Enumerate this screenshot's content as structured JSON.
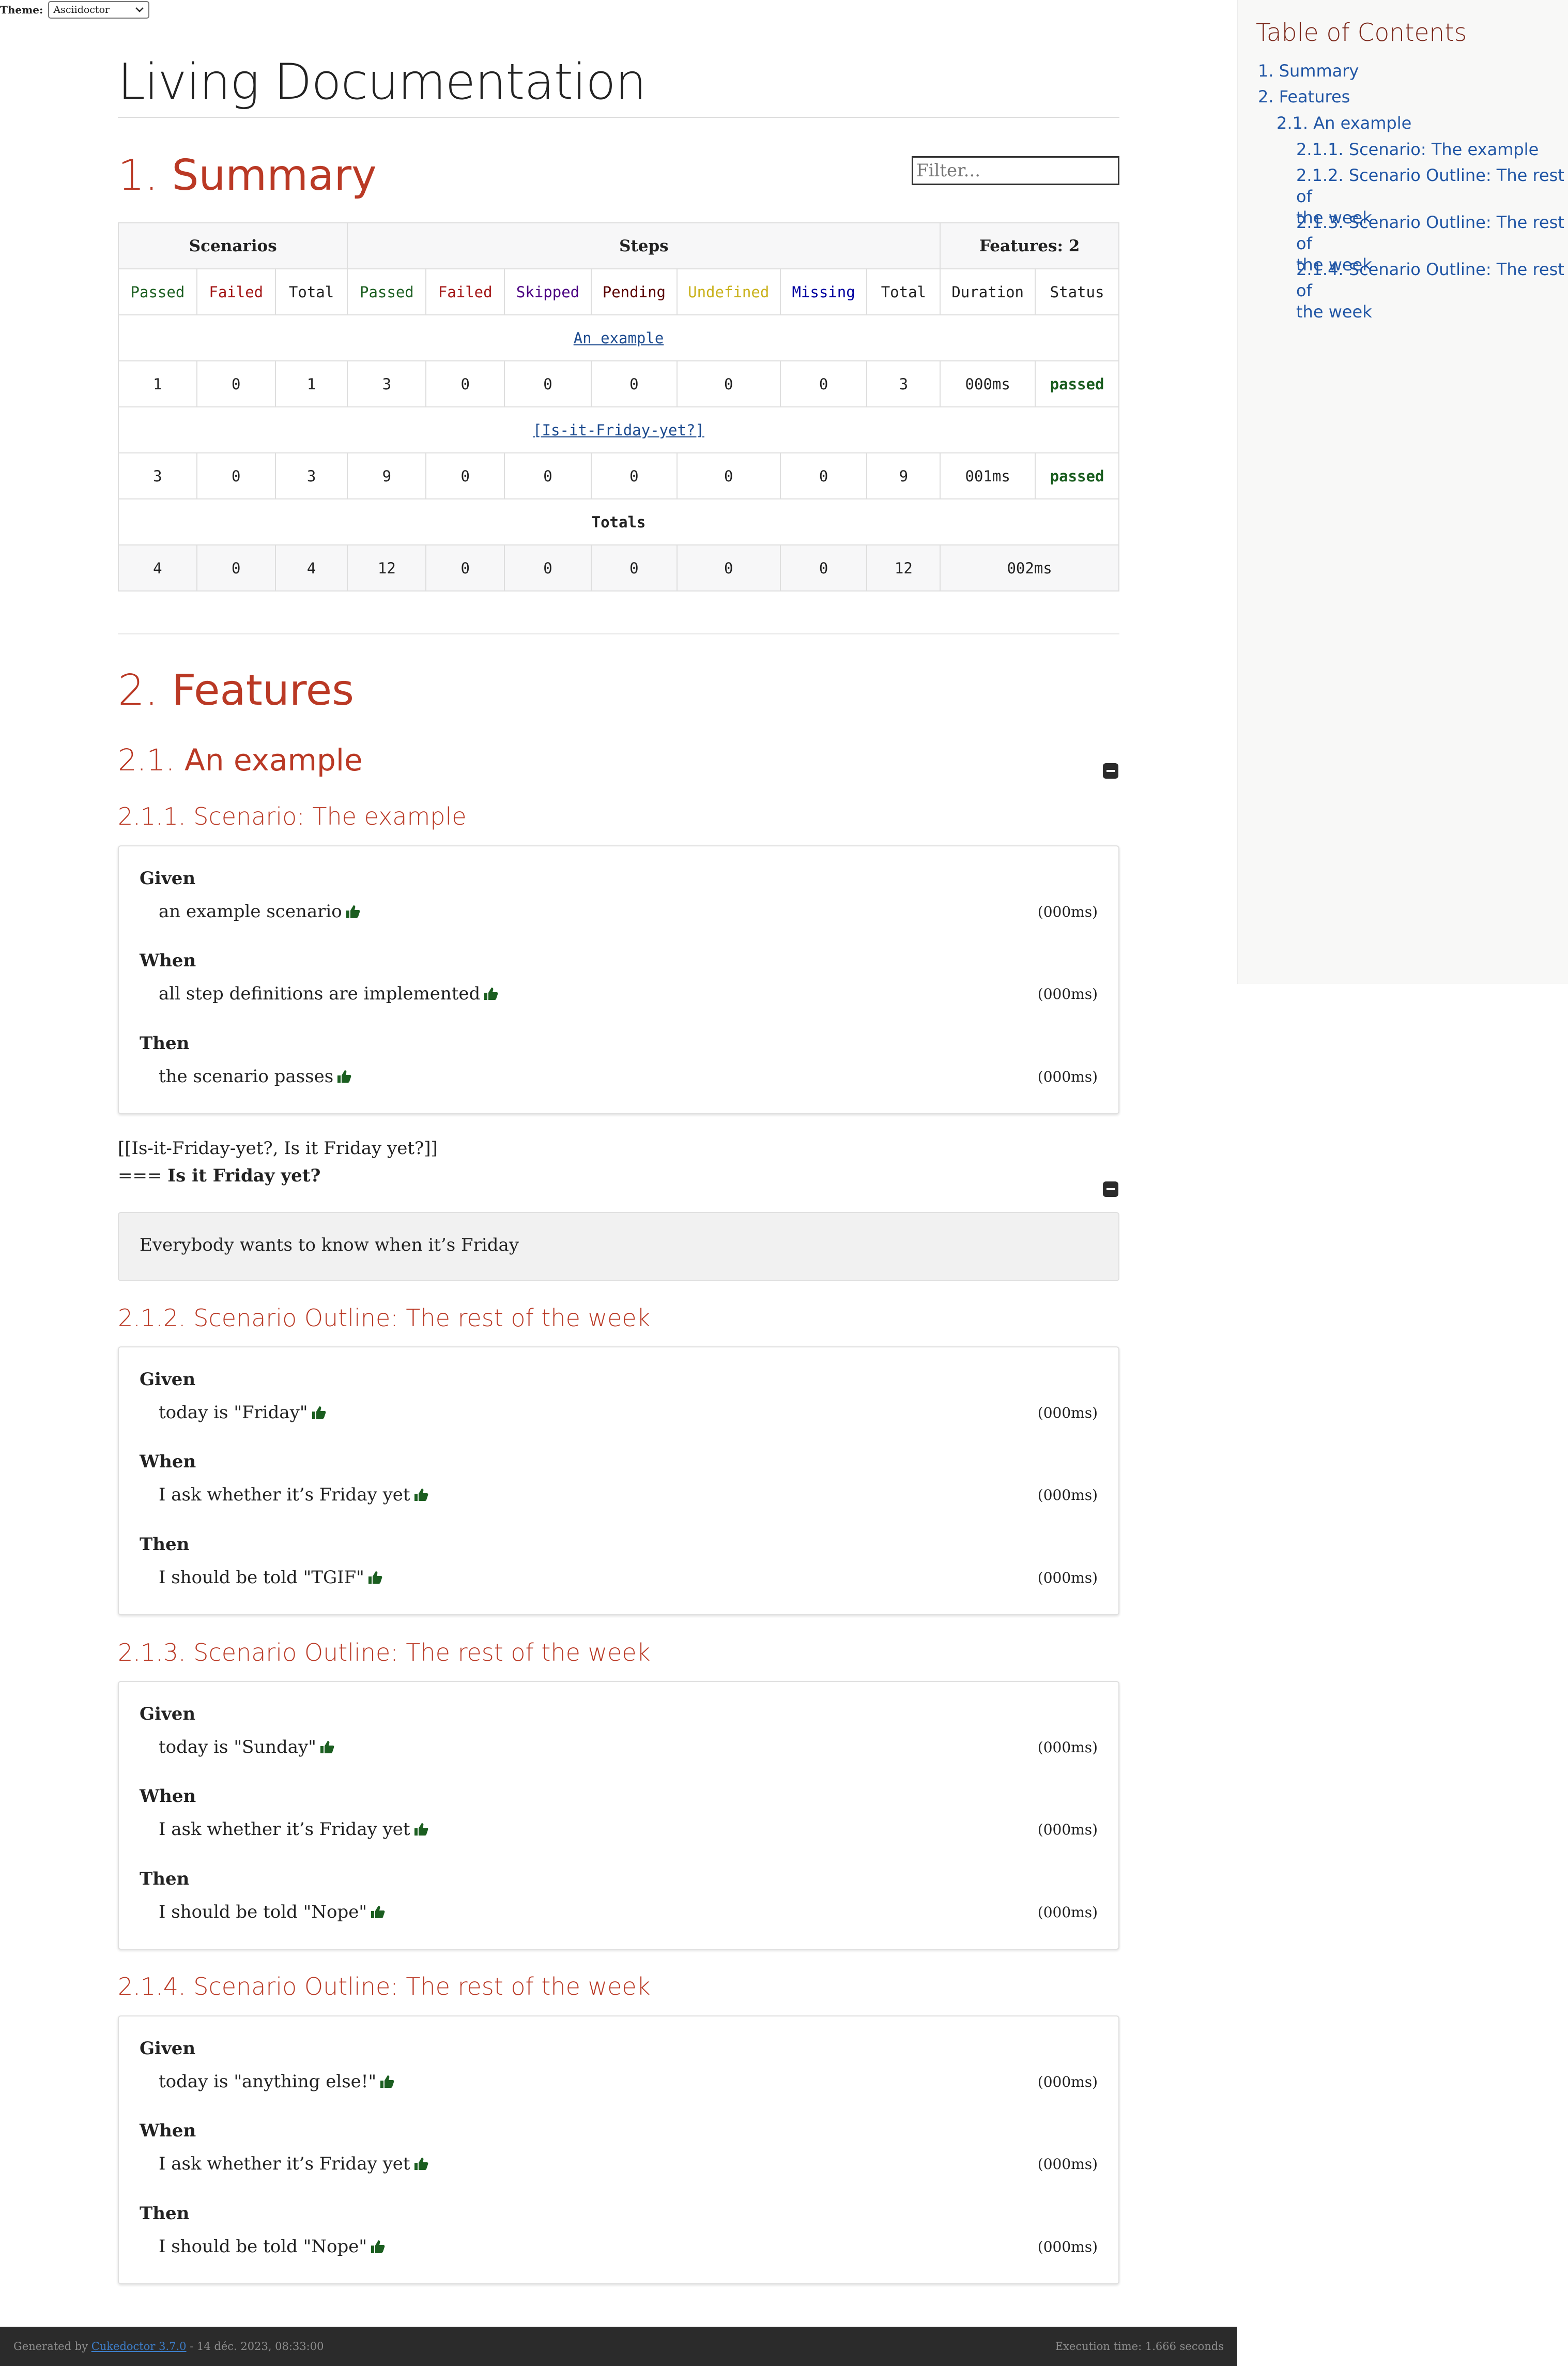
{
  "theme": {
    "label": "Theme:",
    "selected": "Asciidoctor"
  },
  "title": "Living Documentation",
  "filter": {
    "placeholder": "Filter..."
  },
  "summary": {
    "number": "1.",
    "heading": "Summary",
    "group_headers": {
      "scenarios": "Scenarios",
      "steps": "Steps",
      "features": "Features: 2"
    },
    "columns": [
      "Passed",
      "Failed",
      "Total",
      "Passed",
      "Failed",
      "Skipped",
      "Pending",
      "Undefined",
      "Missing",
      "Total",
      "Duration",
      "Status"
    ],
    "features": [
      {
        "name": "An example",
        "values": [
          "1",
          "0",
          "1",
          "3",
          "0",
          "0",
          "0",
          "0",
          "0",
          "3",
          "000ms"
        ],
        "status": "passed"
      },
      {
        "name": "[Is-it-Friday-yet?]",
        "values": [
          "3",
          "0",
          "3",
          "9",
          "0",
          "0",
          "0",
          "0",
          "0",
          "9",
          "001ms"
        ],
        "status": "passed"
      }
    ],
    "totals_label": "Totals",
    "totals": [
      "4",
      "0",
      "4",
      "12",
      "0",
      "0",
      "0",
      "0",
      "0",
      "12",
      "002ms"
    ]
  },
  "features_section": {
    "number": "2.",
    "heading": "Features"
  },
  "feature_example": {
    "number": "2.1.",
    "name": "An example"
  },
  "scenarios": [
    {
      "title": "2.1.1. Scenario: The example",
      "steps": [
        {
          "keyword": "Given",
          "text": "an example scenario",
          "duration": "(000ms)"
        },
        {
          "keyword": "When",
          "text": "all step definitions are implemented",
          "duration": "(000ms)"
        },
        {
          "keyword": "Then",
          "text": "the scenario passes",
          "duration": "(000ms)"
        }
      ]
    },
    {
      "title": "2.1.2. Scenario Outline: The rest of the week",
      "steps": [
        {
          "keyword": "Given",
          "text": "today is \"Friday\"",
          "duration": "(000ms)"
        },
        {
          "keyword": "When",
          "text": "I ask whether it’s Friday yet",
          "duration": "(000ms)"
        },
        {
          "keyword": "Then",
          "text": "I should be told \"TGIF\"",
          "duration": "(000ms)"
        }
      ]
    },
    {
      "title": "2.1.3. Scenario Outline: The rest of the week",
      "steps": [
        {
          "keyword": "Given",
          "text": "today is \"Sunday\"",
          "duration": "(000ms)"
        },
        {
          "keyword": "When",
          "text": "I ask whether it’s Friday yet",
          "duration": "(000ms)"
        },
        {
          "keyword": "Then",
          "text": "I should be told \"Nope\"",
          "duration": "(000ms)"
        }
      ]
    },
    {
      "title": "2.1.4. Scenario Outline: The rest of the week",
      "steps": [
        {
          "keyword": "Given",
          "text": "today is \"anything else!\"",
          "duration": "(000ms)"
        },
        {
          "keyword": "When",
          "text": "I ask whether it’s Friday yet",
          "duration": "(000ms)"
        },
        {
          "keyword": "Then",
          "text": "I should be told \"Nope\"",
          "duration": "(000ms)"
        }
      ]
    }
  ],
  "friday_block": {
    "anchor_line": "[[Is-it-Friday-yet?, Is it Friday yet?]]",
    "heading_prefix": "===",
    "heading": "Is it Friday yet?",
    "description": "Everybody wants to know when it’s Friday"
  },
  "toc": {
    "title": "Table of Contents",
    "items": [
      {
        "num": "1.",
        "text": "Summary"
      },
      {
        "num": "2.",
        "text": "Features"
      },
      {
        "num": "2.1.",
        "text": "An example"
      },
      {
        "line1": "2.1.1. Scenario: The example"
      },
      {
        "line1": "2.1.2. Scenario Outline: The rest of",
        "line2": "the week"
      },
      {
        "line1": "2.1.3. Scenario Outline: The rest of",
        "line2": "the week"
      },
      {
        "line1": "2.1.4. Scenario Outline: The rest of",
        "line2": "the week"
      }
    ]
  },
  "footer": {
    "generated_prefix": "Generated by",
    "generator_link": "Cukedoctor 3.7.0",
    "generated_suffix": "- 14 déc. 2023, 08:33:00",
    "execution_time": "Execution time: 1.666 seconds"
  },
  "colors": {
    "heading": "#ba3925",
    "passed": "#1b5e20",
    "failed": "#a31515",
    "skipped": "#4b0082",
    "pending": "#5a0000",
    "undefined": "#c9b11a",
    "missing": "#0000a0",
    "link": "#2156a5",
    "toc_title": "#7a2518",
    "footer_bg": "#2b2b2b"
  },
  "icons": {
    "step_status": "thumbs-up-icon",
    "collapse": "minus-square-icon",
    "select_arrow": "chevron-down-icon"
  }
}
